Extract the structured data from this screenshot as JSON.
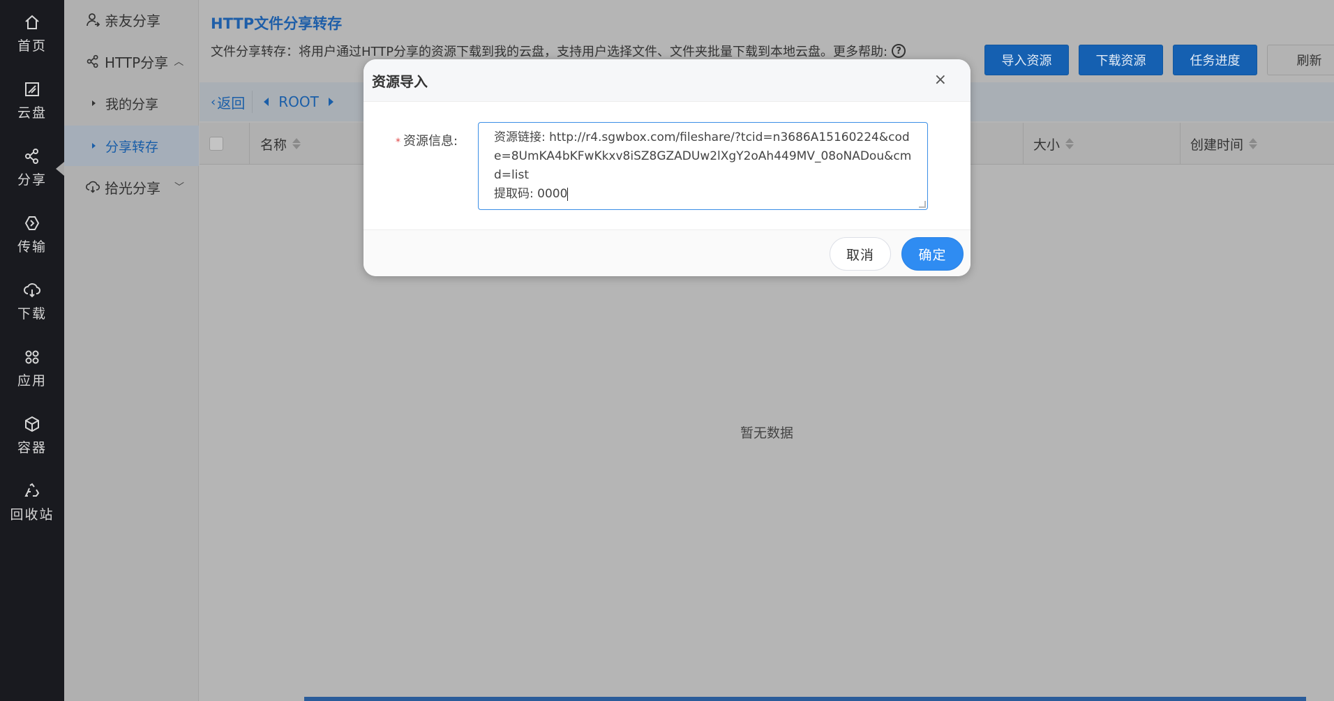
{
  "leftnav": {
    "items": [
      {
        "label": "首页",
        "icon": "home-icon"
      },
      {
        "label": "云盘",
        "icon": "disk-icon"
      },
      {
        "label": "分享",
        "icon": "share-icon"
      },
      {
        "label": "传输",
        "icon": "transfer-icon"
      },
      {
        "label": "下载",
        "icon": "download-icon"
      },
      {
        "label": "应用",
        "icon": "apps-icon"
      },
      {
        "label": "容器",
        "icon": "container-icon"
      },
      {
        "label": "回收站",
        "icon": "recycle-icon"
      }
    ]
  },
  "sidebar": {
    "friends": "亲友分享",
    "http": "HTTP分享",
    "my_share": "我的分享",
    "share_transfer": "分享转存",
    "shiguang": "拾光分享"
  },
  "main": {
    "title": "HTTP文件分享转存",
    "desc": "文件分享转存：将用户通过HTTP分享的资源下载到我的云盘，支持用户选择文件、文件夹批量下载到本地云盘。更多帮助:",
    "buttons": {
      "import": "导入资源",
      "download": "下载资源",
      "progress": "任务进度",
      "refresh": "刷新"
    },
    "path": {
      "back": "返回",
      "root": "ROOT"
    },
    "columns": {
      "name": "名称",
      "size": "大小",
      "created": "创建时间"
    },
    "empty": "暂无数据"
  },
  "modal": {
    "title": "资源导入",
    "close": "×",
    "label": "资源信息:",
    "value_line1": "资源链接: http://r4.sgwbox.com/fileshare/?tcid=n3686A15160224&code=8UmKA4bKFwKkxv8iSZ8GZADUw2lXgY2oAh449MV_08oNADou&cmd=list",
    "value_line2": "提取码: 0000",
    "cancel": "取消",
    "ok": "确定"
  },
  "colors": {
    "accent": "#2f8cf2",
    "title_blue": "#1e5ea8",
    "nav_bg": "#191a1f"
  }
}
